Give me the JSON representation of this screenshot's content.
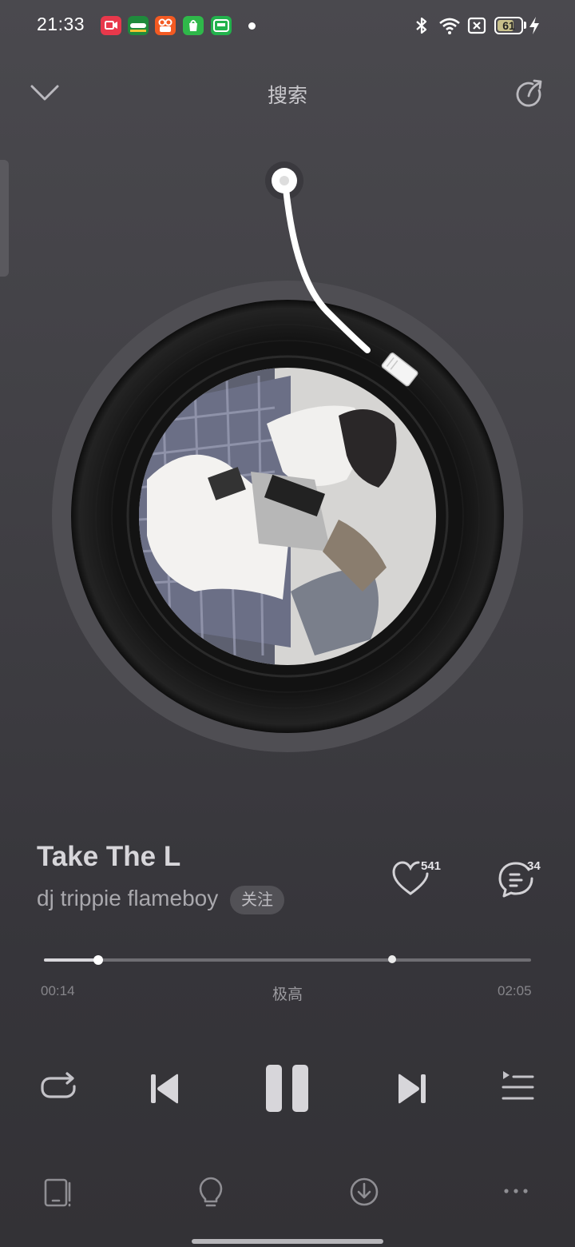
{
  "status_bar": {
    "time": "21:33",
    "battery": "61",
    "app_icons": [
      "screen-recorder-icon",
      "oppo-store-icon",
      "kuaishou-icon",
      "shopping-icon",
      "iqiyi-icon"
    ],
    "indicators": [
      "bluetooth-icon",
      "wifi-icon",
      "no-sim-icon",
      "battery-icon",
      "charging-icon"
    ]
  },
  "header": {
    "title": "搜索",
    "collapse_icon": "chevron-down-icon",
    "share_icon": "share-icon"
  },
  "player": {
    "song_title": "Take The L",
    "artist": "dj trippie flameboy",
    "follow_label": "关注",
    "like_count": "541",
    "comment_count": "34",
    "current_time": "00:14",
    "total_time": "02:05",
    "progress": 0.112,
    "buffered": 0.715,
    "quality": "极高"
  },
  "controls": [
    "repeat-icon",
    "previous-icon",
    "pause-icon",
    "next-icon",
    "playlist-icon"
  ],
  "bottom_bar": [
    "device-icon",
    "lightbulb-icon",
    "download-icon",
    "more-icon"
  ],
  "colors": {
    "background": "#3f3e43",
    "accent": "#ffffff",
    "vinyl": "#111111"
  }
}
